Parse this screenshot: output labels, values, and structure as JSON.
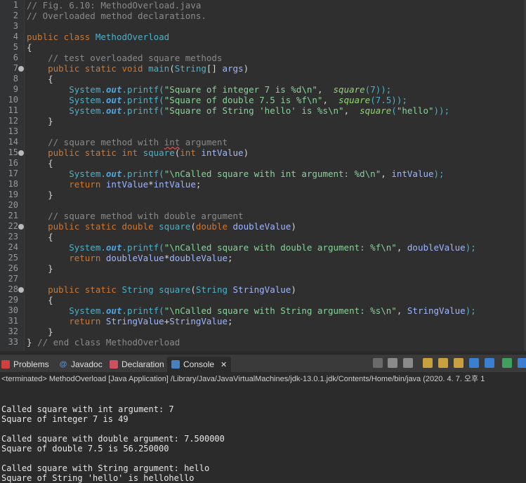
{
  "editor": {
    "line_numbers": [
      "1",
      "2",
      "3",
      "4",
      "5",
      "6",
      "7",
      "8",
      "9",
      "10",
      "11",
      "12",
      "13",
      "14",
      "15",
      "16",
      "17",
      "18",
      "19",
      "20",
      "21",
      "22",
      "23",
      "24",
      "25",
      "26",
      "27",
      "28",
      "29",
      "30",
      "31",
      "32",
      "33"
    ],
    "fold_lines": [
      "7",
      "15",
      "22",
      "28"
    ],
    "lines": [
      [
        {
          "t": "// Fig. 6.10: MethodOverload.java",
          "c": "cm"
        }
      ],
      [
        {
          "t": "// Overloaded method declarations.",
          "c": "cm"
        }
      ],
      [],
      [
        {
          "t": "public class ",
          "c": "kw"
        },
        {
          "t": "MethodOverload",
          "c": "ty"
        }
      ],
      [
        {
          "t": "{",
          "c": ""
        }
      ],
      [
        {
          "t": "    // test overloaded square methods",
          "c": "cm"
        }
      ],
      [
        {
          "t": "    public static void ",
          "c": "kw"
        },
        {
          "t": "main",
          "c": "fn"
        },
        {
          "t": "(",
          "c": ""
        },
        {
          "t": "String",
          "c": "ty"
        },
        {
          "t": "[] ",
          "c": ""
        },
        {
          "t": "args",
          "c": "var"
        },
        {
          "t": ")",
          "c": ""
        }
      ],
      [
        {
          "t": "    {",
          "c": ""
        }
      ],
      [
        {
          "t": "        System.",
          "c": "ty"
        },
        {
          "t": "out",
          "c": "fld"
        },
        {
          "t": ".printf(",
          "c": "ty"
        },
        {
          "t": "\"Square of integer 7 is %d\\n\"",
          "c": "str"
        },
        {
          "t": ",  ",
          "c": ""
        },
        {
          "t": "square",
          "c": "mcall"
        },
        {
          "t": "(7));",
          "c": "ty"
        }
      ],
      [
        {
          "t": "        System.",
          "c": "ty"
        },
        {
          "t": "out",
          "c": "fld"
        },
        {
          "t": ".printf(",
          "c": "ty"
        },
        {
          "t": "\"Square of double 7.5 is %f\\n\"",
          "c": "str"
        },
        {
          "t": ",  ",
          "c": ""
        },
        {
          "t": "square",
          "c": "mcall"
        },
        {
          "t": "(7.5));",
          "c": "ty"
        }
      ],
      [
        {
          "t": "        System.",
          "c": "ty"
        },
        {
          "t": "out",
          "c": "fld"
        },
        {
          "t": ".printf(",
          "c": "ty"
        },
        {
          "t": "\"Square of String 'hello' is %s\\n\"",
          "c": "str"
        },
        {
          "t": ",  ",
          "c": ""
        },
        {
          "t": "square",
          "c": "mcall"
        },
        {
          "t": "(",
          "c": "ty"
        },
        {
          "t": "\"hello\"",
          "c": "str"
        },
        {
          "t": "));",
          "c": "ty"
        }
      ],
      [
        {
          "t": "    }",
          "c": ""
        }
      ],
      [],
      [
        {
          "t": "    // square method with ",
          "c": "cm"
        },
        {
          "t": "int",
          "c": "cm err"
        },
        {
          "t": " argument",
          "c": "cm"
        }
      ],
      [
        {
          "t": "    public static int ",
          "c": "kw"
        },
        {
          "t": "square",
          "c": "fn"
        },
        {
          "t": "(",
          "c": ""
        },
        {
          "t": "int ",
          "c": "kw"
        },
        {
          "t": "intValue",
          "c": "var"
        },
        {
          "t": ")",
          "c": ""
        }
      ],
      [
        {
          "t": "    {",
          "c": ""
        }
      ],
      [
        {
          "t": "        System.",
          "c": "ty"
        },
        {
          "t": "out",
          "c": "fld"
        },
        {
          "t": ".printf(",
          "c": "ty"
        },
        {
          "t": "\"\\nCalled square with int argument: %d\\n\"",
          "c": "str"
        },
        {
          "t": ", ",
          "c": ""
        },
        {
          "t": "intValue",
          "c": "var"
        },
        {
          "t": ");",
          "c": "ty"
        }
      ],
      [
        {
          "t": "        return ",
          "c": "kw"
        },
        {
          "t": "intValue",
          "c": "var"
        },
        {
          "t": "*",
          "c": ""
        },
        {
          "t": "intValue",
          "c": "var"
        },
        {
          "t": ";",
          "c": ""
        }
      ],
      [
        {
          "t": "    }",
          "c": ""
        }
      ],
      [],
      [
        {
          "t": "    // square method with double argument",
          "c": "cm"
        }
      ],
      [
        {
          "t": "    public static double ",
          "c": "kw"
        },
        {
          "t": "square",
          "c": "fn"
        },
        {
          "t": "(",
          "c": ""
        },
        {
          "t": "double ",
          "c": "kw"
        },
        {
          "t": "doubleValue",
          "c": "var"
        },
        {
          "t": ")",
          "c": ""
        }
      ],
      [
        {
          "t": "    {",
          "c": ""
        }
      ],
      [
        {
          "t": "        System.",
          "c": "ty"
        },
        {
          "t": "out",
          "c": "fld"
        },
        {
          "t": ".printf(",
          "c": "ty"
        },
        {
          "t": "\"\\nCalled square with double argument: %f\\n\"",
          "c": "str"
        },
        {
          "t": ", ",
          "c": ""
        },
        {
          "t": "doubleValue",
          "c": "var"
        },
        {
          "t": ");",
          "c": "ty"
        }
      ],
      [
        {
          "t": "        return ",
          "c": "kw"
        },
        {
          "t": "doubleValue",
          "c": "var"
        },
        {
          "t": "*",
          "c": ""
        },
        {
          "t": "doubleValue",
          "c": "var"
        },
        {
          "t": ";",
          "c": ""
        }
      ],
      [
        {
          "t": "    }",
          "c": ""
        }
      ],
      [],
      [
        {
          "t": "    public static ",
          "c": "kw"
        },
        {
          "t": "String ",
          "c": "ty"
        },
        {
          "t": "square",
          "c": "fn"
        },
        {
          "t": "(",
          "c": ""
        },
        {
          "t": "String ",
          "c": "ty"
        },
        {
          "t": "StringValue",
          "c": "var"
        },
        {
          "t": ")",
          "c": ""
        }
      ],
      [
        {
          "t": "    {",
          "c": ""
        }
      ],
      [
        {
          "t": "        System.",
          "c": "ty"
        },
        {
          "t": "out",
          "c": "fld"
        },
        {
          "t": ".printf(",
          "c": "ty"
        },
        {
          "t": "\"\\nCalled square with String argument: %s\\n\"",
          "c": "str"
        },
        {
          "t": ", ",
          "c": ""
        },
        {
          "t": "StringValue",
          "c": "var"
        },
        {
          "t": ");",
          "c": "ty"
        }
      ],
      [
        {
          "t": "        return ",
          "c": "kw"
        },
        {
          "t": "StringValue",
          "c": "var"
        },
        {
          "t": "+",
          "c": ""
        },
        {
          "t": "StringValue",
          "c": "var"
        },
        {
          "t": ";",
          "c": ""
        }
      ],
      [
        {
          "t": "    }",
          "c": ""
        }
      ],
      [
        {
          "t": "} ",
          "c": ""
        },
        {
          "t": "// end class MethodOverload",
          "c": "cm"
        }
      ]
    ]
  },
  "tabs": [
    {
      "label": "Problems",
      "icon": "problems-icon",
      "color": "#d04040"
    },
    {
      "label": "Javadoc",
      "icon": "javadoc-icon",
      "color": "#5a8fd8"
    },
    {
      "label": "Declaration",
      "icon": "declaration-icon",
      "color": "#d05060"
    },
    {
      "label": "Console",
      "icon": "console-icon",
      "color": "#4a7fc0"
    }
  ],
  "console": {
    "close_glyph": "✕",
    "status": "<terminated> MethodOverload [Java Application] /Library/Java/JavaVirtualMachines/jdk-13.0.1.jdk/Contents/Home/bin/java (2020. 4. 7. 오후 1",
    "output": [
      "",
      "Called square with int argument: 7",
      "Square of integer 7 is 49",
      "",
      "Called square with double argument: 7.500000",
      "Square of double 7.5 is 56.250000",
      "",
      "Called square with String argument: hello",
      "Square of String 'hello' is hellohello"
    ]
  },
  "toolbar": {
    "buttons": [
      {
        "name": "terminate-button",
        "color": "#6a6a6a"
      },
      {
        "name": "remove-launch-button",
        "color": "#8a8a8a"
      },
      {
        "name": "remove-all-button",
        "color": "#8a8a8a"
      },
      {
        "name": "scroll-lock-button",
        "color": "#c8a040"
      },
      {
        "name": "word-wrap-button",
        "color": "#c8a040"
      },
      {
        "name": "show-on-output-button",
        "color": "#c8a040"
      },
      {
        "name": "pin-console-button",
        "color": "#3b7fd0"
      },
      {
        "name": "display-console-button",
        "color": "#3b7fd0"
      },
      {
        "name": "open-console-button",
        "color": "#40a060"
      },
      {
        "name": "new-console-button",
        "color": "#3b7fd0"
      }
    ]
  }
}
